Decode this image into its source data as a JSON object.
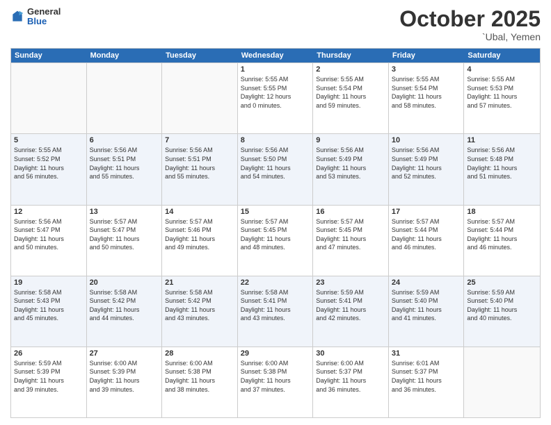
{
  "logo": {
    "general": "General",
    "blue": "Blue"
  },
  "header": {
    "month": "October 2025",
    "location": "`Ubal, Yemen"
  },
  "weekdays": [
    "Sunday",
    "Monday",
    "Tuesday",
    "Wednesday",
    "Thursday",
    "Friday",
    "Saturday"
  ],
  "rows": [
    [
      {
        "day": "",
        "lines": []
      },
      {
        "day": "",
        "lines": []
      },
      {
        "day": "",
        "lines": []
      },
      {
        "day": "1",
        "lines": [
          "Sunrise: 5:55 AM",
          "Sunset: 5:55 PM",
          "Daylight: 12 hours",
          "and 0 minutes."
        ]
      },
      {
        "day": "2",
        "lines": [
          "Sunrise: 5:55 AM",
          "Sunset: 5:54 PM",
          "Daylight: 11 hours",
          "and 59 minutes."
        ]
      },
      {
        "day": "3",
        "lines": [
          "Sunrise: 5:55 AM",
          "Sunset: 5:54 PM",
          "Daylight: 11 hours",
          "and 58 minutes."
        ]
      },
      {
        "day": "4",
        "lines": [
          "Sunrise: 5:55 AM",
          "Sunset: 5:53 PM",
          "Daylight: 11 hours",
          "and 57 minutes."
        ]
      }
    ],
    [
      {
        "day": "5",
        "lines": [
          "Sunrise: 5:55 AM",
          "Sunset: 5:52 PM",
          "Daylight: 11 hours",
          "and 56 minutes."
        ]
      },
      {
        "day": "6",
        "lines": [
          "Sunrise: 5:56 AM",
          "Sunset: 5:51 PM",
          "Daylight: 11 hours",
          "and 55 minutes."
        ]
      },
      {
        "day": "7",
        "lines": [
          "Sunrise: 5:56 AM",
          "Sunset: 5:51 PM",
          "Daylight: 11 hours",
          "and 55 minutes."
        ]
      },
      {
        "day": "8",
        "lines": [
          "Sunrise: 5:56 AM",
          "Sunset: 5:50 PM",
          "Daylight: 11 hours",
          "and 54 minutes."
        ]
      },
      {
        "day": "9",
        "lines": [
          "Sunrise: 5:56 AM",
          "Sunset: 5:49 PM",
          "Daylight: 11 hours",
          "and 53 minutes."
        ]
      },
      {
        "day": "10",
        "lines": [
          "Sunrise: 5:56 AM",
          "Sunset: 5:49 PM",
          "Daylight: 11 hours",
          "and 52 minutes."
        ]
      },
      {
        "day": "11",
        "lines": [
          "Sunrise: 5:56 AM",
          "Sunset: 5:48 PM",
          "Daylight: 11 hours",
          "and 51 minutes."
        ]
      }
    ],
    [
      {
        "day": "12",
        "lines": [
          "Sunrise: 5:56 AM",
          "Sunset: 5:47 PM",
          "Daylight: 11 hours",
          "and 50 minutes."
        ]
      },
      {
        "day": "13",
        "lines": [
          "Sunrise: 5:57 AM",
          "Sunset: 5:47 PM",
          "Daylight: 11 hours",
          "and 50 minutes."
        ]
      },
      {
        "day": "14",
        "lines": [
          "Sunrise: 5:57 AM",
          "Sunset: 5:46 PM",
          "Daylight: 11 hours",
          "and 49 minutes."
        ]
      },
      {
        "day": "15",
        "lines": [
          "Sunrise: 5:57 AM",
          "Sunset: 5:45 PM",
          "Daylight: 11 hours",
          "and 48 minutes."
        ]
      },
      {
        "day": "16",
        "lines": [
          "Sunrise: 5:57 AM",
          "Sunset: 5:45 PM",
          "Daylight: 11 hours",
          "and 47 minutes."
        ]
      },
      {
        "day": "17",
        "lines": [
          "Sunrise: 5:57 AM",
          "Sunset: 5:44 PM",
          "Daylight: 11 hours",
          "and 46 minutes."
        ]
      },
      {
        "day": "18",
        "lines": [
          "Sunrise: 5:57 AM",
          "Sunset: 5:44 PM",
          "Daylight: 11 hours",
          "and 46 minutes."
        ]
      }
    ],
    [
      {
        "day": "19",
        "lines": [
          "Sunrise: 5:58 AM",
          "Sunset: 5:43 PM",
          "Daylight: 11 hours",
          "and 45 minutes."
        ]
      },
      {
        "day": "20",
        "lines": [
          "Sunrise: 5:58 AM",
          "Sunset: 5:42 PM",
          "Daylight: 11 hours",
          "and 44 minutes."
        ]
      },
      {
        "day": "21",
        "lines": [
          "Sunrise: 5:58 AM",
          "Sunset: 5:42 PM",
          "Daylight: 11 hours",
          "and 43 minutes."
        ]
      },
      {
        "day": "22",
        "lines": [
          "Sunrise: 5:58 AM",
          "Sunset: 5:41 PM",
          "Daylight: 11 hours",
          "and 43 minutes."
        ]
      },
      {
        "day": "23",
        "lines": [
          "Sunrise: 5:59 AM",
          "Sunset: 5:41 PM",
          "Daylight: 11 hours",
          "and 42 minutes."
        ]
      },
      {
        "day": "24",
        "lines": [
          "Sunrise: 5:59 AM",
          "Sunset: 5:40 PM",
          "Daylight: 11 hours",
          "and 41 minutes."
        ]
      },
      {
        "day": "25",
        "lines": [
          "Sunrise: 5:59 AM",
          "Sunset: 5:40 PM",
          "Daylight: 11 hours",
          "and 40 minutes."
        ]
      }
    ],
    [
      {
        "day": "26",
        "lines": [
          "Sunrise: 5:59 AM",
          "Sunset: 5:39 PM",
          "Daylight: 11 hours",
          "and 39 minutes."
        ]
      },
      {
        "day": "27",
        "lines": [
          "Sunrise: 6:00 AM",
          "Sunset: 5:39 PM",
          "Daylight: 11 hours",
          "and 39 minutes."
        ]
      },
      {
        "day": "28",
        "lines": [
          "Sunrise: 6:00 AM",
          "Sunset: 5:38 PM",
          "Daylight: 11 hours",
          "and 38 minutes."
        ]
      },
      {
        "day": "29",
        "lines": [
          "Sunrise: 6:00 AM",
          "Sunset: 5:38 PM",
          "Daylight: 11 hours",
          "and 37 minutes."
        ]
      },
      {
        "day": "30",
        "lines": [
          "Sunrise: 6:00 AM",
          "Sunset: 5:37 PM",
          "Daylight: 11 hours",
          "and 36 minutes."
        ]
      },
      {
        "day": "31",
        "lines": [
          "Sunrise: 6:01 AM",
          "Sunset: 5:37 PM",
          "Daylight: 11 hours",
          "and 36 minutes."
        ]
      },
      {
        "day": "",
        "lines": []
      }
    ]
  ]
}
